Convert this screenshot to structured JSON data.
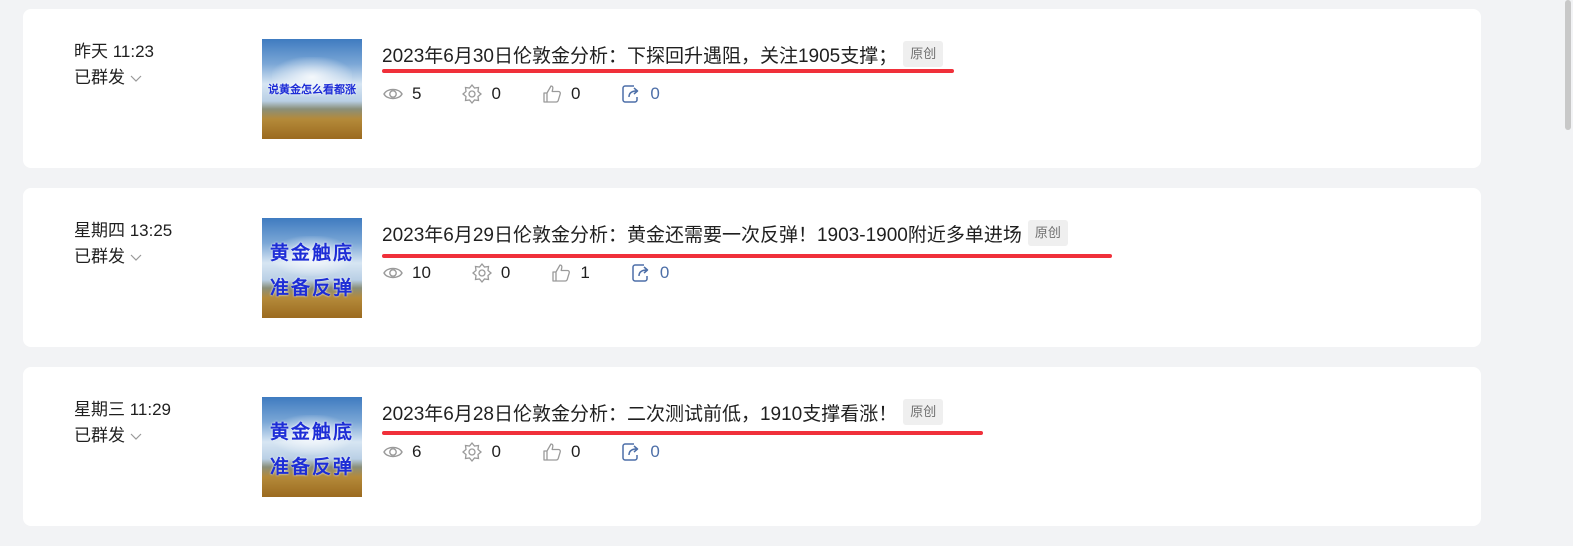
{
  "articles": [
    {
      "time": "昨天 11:23",
      "status": "已群发",
      "title": "2023年6月30日伦敦金分析：下探回升遇阻，关注1905支撑；",
      "badge": "原创",
      "thumbnail_text": "说黄金怎么看都涨",
      "views": "5",
      "wows": "0",
      "likes": "0",
      "shares": "0"
    },
    {
      "time": "星期四 13:25",
      "status": "已群发",
      "title": "2023年6月29日伦敦金分析：黄金还需要一次反弹！1903-1900附近多单进场",
      "badge": "原创",
      "thumbnail_line1": "黄金触底",
      "thumbnail_line2": "准备反弹",
      "views": "10",
      "wows": "0",
      "likes": "1",
      "shares": "0"
    },
    {
      "time": "星期三 11:29",
      "status": "已群发",
      "title": "2023年6月28日伦敦金分析：二次测试前低，1910支撑看涨！",
      "badge": "原创",
      "thumbnail_line1": "黄金触底",
      "thumbnail_line2": "准备反弹",
      "views": "6",
      "wows": "0",
      "likes": "0",
      "shares": "0"
    }
  ],
  "icons": {
    "views": "eye-icon",
    "wows": "wow-icon",
    "likes": "thumbs-up-icon",
    "shares": "share-icon",
    "status_dropdown": "chevron-down-icon"
  },
  "colors": {
    "underline": "#f0303a",
    "share_count": "#4d6fa8",
    "page_bg": "#f2f3f5",
    "card_bg": "#ffffff"
  }
}
